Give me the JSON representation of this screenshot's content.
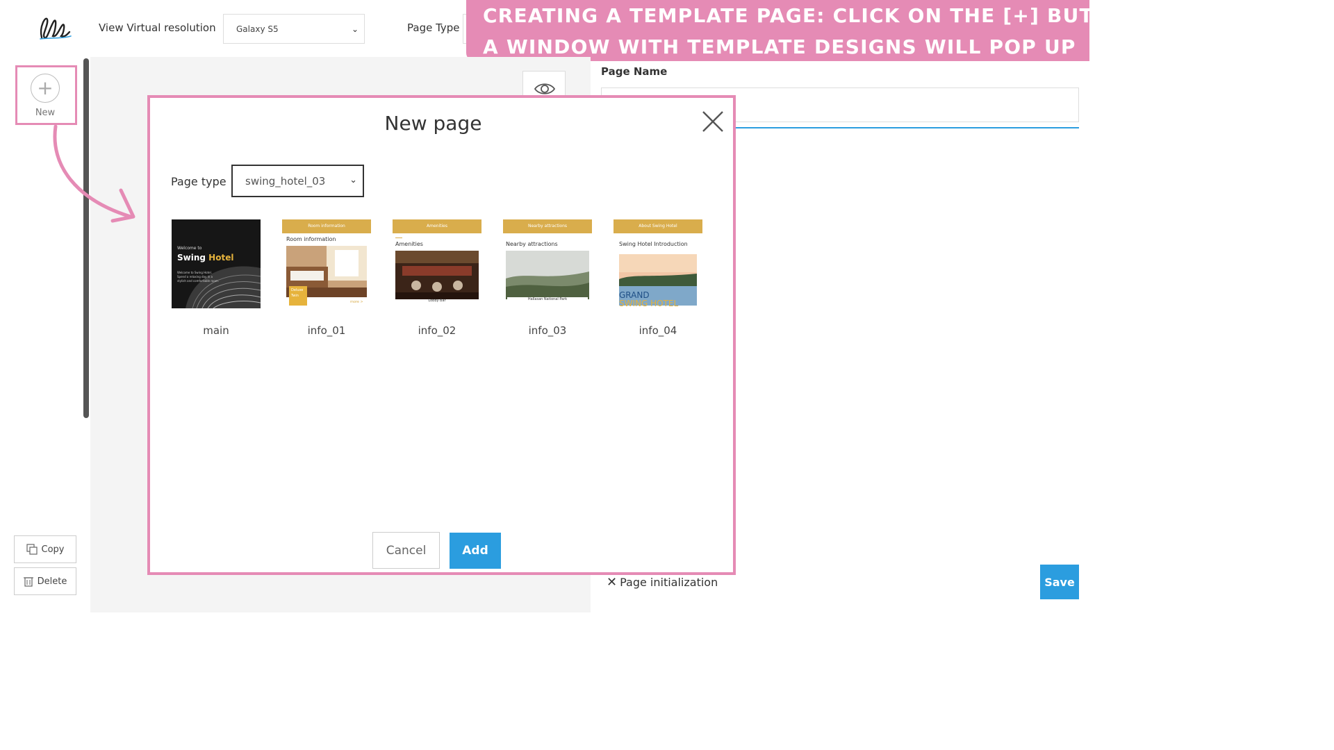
{
  "topbar": {
    "view_resolution_label": "View Virtual resolution",
    "view_resolution_value": "Galaxy S5",
    "page_type_label": "Page Type"
  },
  "banner": {
    "line1": "CREATING A TEMPLATE PAGE: CLICK ON THE [+] BUTTON,",
    "line2": "A WINDOW WITH TEMPLATE DESIGNS WILL POP UP"
  },
  "sidebar": {
    "new_label": "New",
    "copy_label": "Copy",
    "delete_label": "Delete"
  },
  "right_panel": {
    "page_name_label": "Page Name",
    "page_name_value": "",
    "page_init_label": "Page initialization",
    "save_label": "Save"
  },
  "modal": {
    "title": "New page",
    "page_type_label": "Page type",
    "page_type_value": "swing_hotel_03",
    "templates": [
      {
        "name": "main",
        "thumb_title_small": "Welcome to",
        "thumb_title_a": "Swing",
        "thumb_title_b": "Hotel",
        "thumb_body": "Welcome to Swing Hotel. Spend a relaxing day in a stylish and comfortable room."
      },
      {
        "name": "info_01",
        "bar": "Room information",
        "heading": "Room information",
        "tag1": "Deluxe",
        "tag2": "Twin",
        "more": "more >"
      },
      {
        "name": "info_02",
        "bar": "Amenities",
        "heading": "Amenities",
        "caption": "Lobby Bar"
      },
      {
        "name": "info_03",
        "bar": "Nearby attractions",
        "heading": "Nearby attractions",
        "caption": "Hallasan National Park"
      },
      {
        "name": "info_04",
        "bar": "About Swing Hotel",
        "heading": "Swing Hotel Introduction",
        "overlay1": "GRAND",
        "overlay2": "SWING HOTEL"
      }
    ],
    "cancel_label": "Cancel",
    "add_label": "Add"
  },
  "colors": {
    "accent_pink": "#e58bb5",
    "primary_blue": "#2b9ddf",
    "template_gold": "#d9ad4c"
  }
}
